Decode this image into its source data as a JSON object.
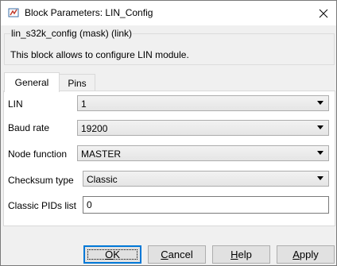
{
  "window": {
    "title": "Block Parameters: LIN_Config",
    "close_icon": "close-icon",
    "app_icon": "matlab-icon"
  },
  "mask": {
    "legend": "lin_s32k_config (mask) (link)",
    "description": "This block allows to configure LIN module."
  },
  "tabs": [
    {
      "label": "General",
      "active": true
    },
    {
      "label": "Pins",
      "active": false
    }
  ],
  "fields": {
    "lin": {
      "label": "LIN",
      "value": "1"
    },
    "baud_rate": {
      "label": "Baud rate",
      "value": "19200"
    },
    "node_function": {
      "label": "Node function",
      "value": "MASTER"
    },
    "checksum_type": {
      "label": "Checksum type",
      "value": "Classic"
    },
    "classic_pids": {
      "label": "Classic PIDs list",
      "value": "0"
    }
  },
  "buttons": {
    "ok": {
      "label": "OK",
      "underline": "O",
      "rest": "K"
    },
    "cancel": {
      "label": "Cancel",
      "underline": "C",
      "rest": "ancel"
    },
    "help": {
      "label": "Help",
      "underline": "H",
      "rest": "elp"
    },
    "apply": {
      "label": "Apply",
      "underline": "A",
      "rest": "pply"
    }
  },
  "colors": {
    "accent": "#0078d7",
    "panel_bg": "#ffffff",
    "dialog_bg": "#f0f0f0"
  }
}
